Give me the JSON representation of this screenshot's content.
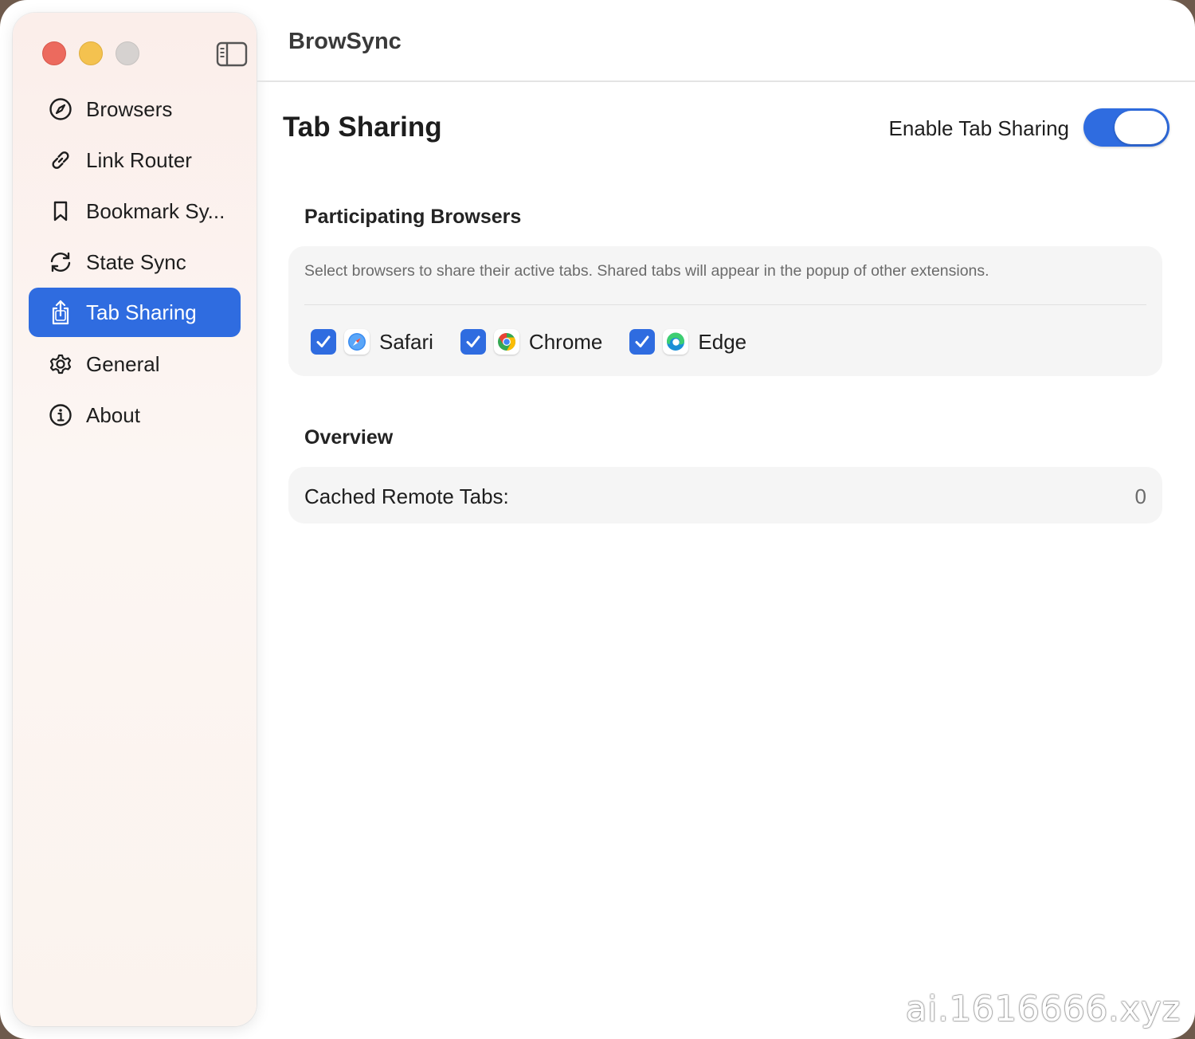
{
  "app": {
    "title": "BrowSync"
  },
  "sidebar": {
    "items": [
      {
        "label": "Browsers",
        "icon": "compass-icon",
        "selected": false
      },
      {
        "label": "Link Router",
        "icon": "link-icon",
        "selected": false
      },
      {
        "label": "Bookmark Sy...",
        "icon": "bookmark-icon",
        "selected": false
      },
      {
        "label": "State Sync",
        "icon": "sync-icon",
        "selected": false
      },
      {
        "label": "Tab Sharing",
        "icon": "share-icon",
        "selected": true
      },
      {
        "label": "General",
        "icon": "gear-icon",
        "selected": false
      },
      {
        "label": "About",
        "icon": "info-icon",
        "selected": false
      }
    ]
  },
  "main": {
    "page_title": "Tab Sharing",
    "enable_toggle": {
      "label": "Enable Tab Sharing",
      "on": true
    },
    "participating": {
      "title": "Participating Browsers",
      "description": "Select browsers to share their active tabs. Shared tabs will appear in the popup of other extensions.",
      "browsers": [
        {
          "name": "Safari",
          "checked": true,
          "icon": "safari-icon"
        },
        {
          "name": "Chrome",
          "checked": true,
          "icon": "chrome-icon"
        },
        {
          "name": "Edge",
          "checked": true,
          "icon": "edge-icon"
        }
      ]
    },
    "overview": {
      "title": "Overview",
      "cached_label": "Cached Remote Tabs:",
      "cached_value": "0"
    }
  },
  "watermark": "ai.1616666.xyz",
  "colors": {
    "accent": "#2f6ce0",
    "close": "#ec6a5e",
    "minimize": "#f4c24f",
    "zoom": "#d6d2d0"
  }
}
